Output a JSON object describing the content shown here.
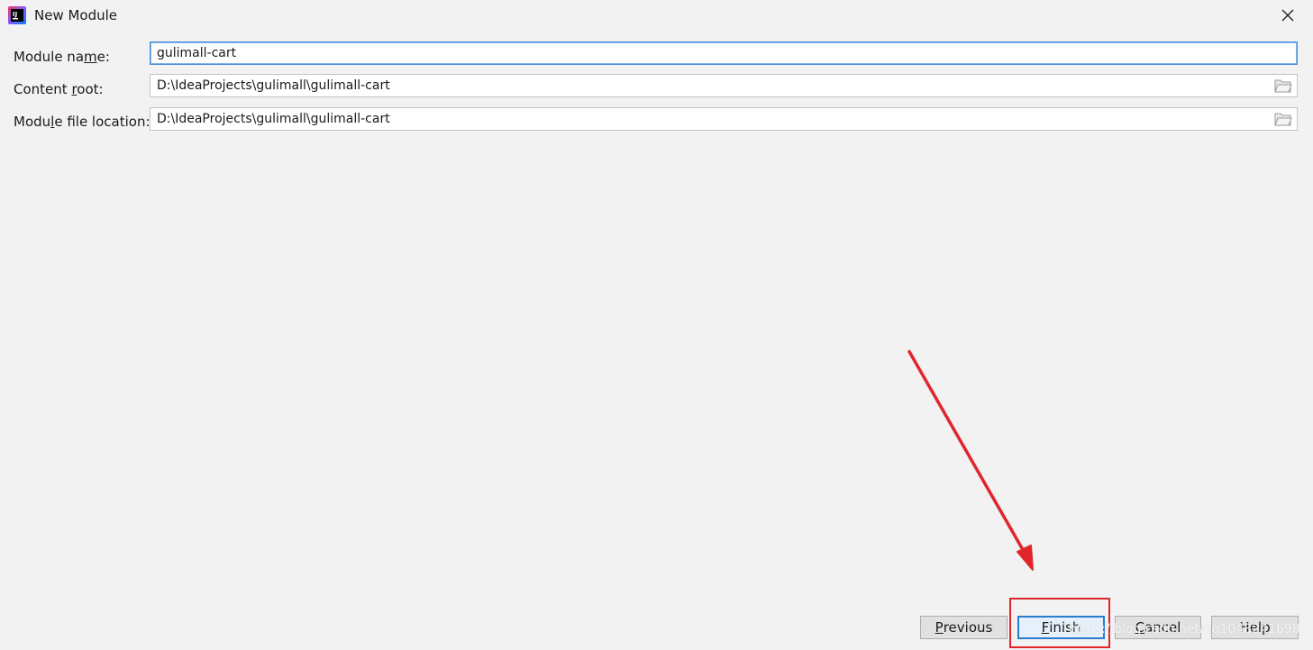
{
  "window": {
    "title": "New Module",
    "icon": "intellij-idea-icon",
    "close_icon": "close-icon"
  },
  "form": {
    "module_name": {
      "label_pre": "Module na",
      "label_mnemonic": "m",
      "label_post": "e:",
      "value": "gulimall-cart"
    },
    "content_root": {
      "label_pre": "Content ",
      "label_mnemonic": "r",
      "label_post": "oot:",
      "value": "D:\\IdeaProjects\\gulimall\\gulimall-cart"
    },
    "module_file_location": {
      "label_pre": "Modu",
      "label_mnemonic": "l",
      "label_post": "e file location:",
      "value": "D:\\IdeaProjects\\gulimall\\gulimall-cart"
    }
  },
  "buttons": {
    "previous": {
      "mnemonic": "P",
      "rest": "revious"
    },
    "finish": {
      "mnemonic": "F",
      "rest": "inish"
    },
    "cancel": {
      "mnemonic": "C",
      "rest": "ancel"
    },
    "help": {
      "label": "Help"
    }
  },
  "annotation": {
    "color": "#e0262b"
  },
  "watermark": "https://blog.csdn.net/qq1048241698",
  "colors": {
    "background": "#f2f2f2",
    "focus_border": "#4a8fd6",
    "default_button_border": "#2b7bd0"
  }
}
